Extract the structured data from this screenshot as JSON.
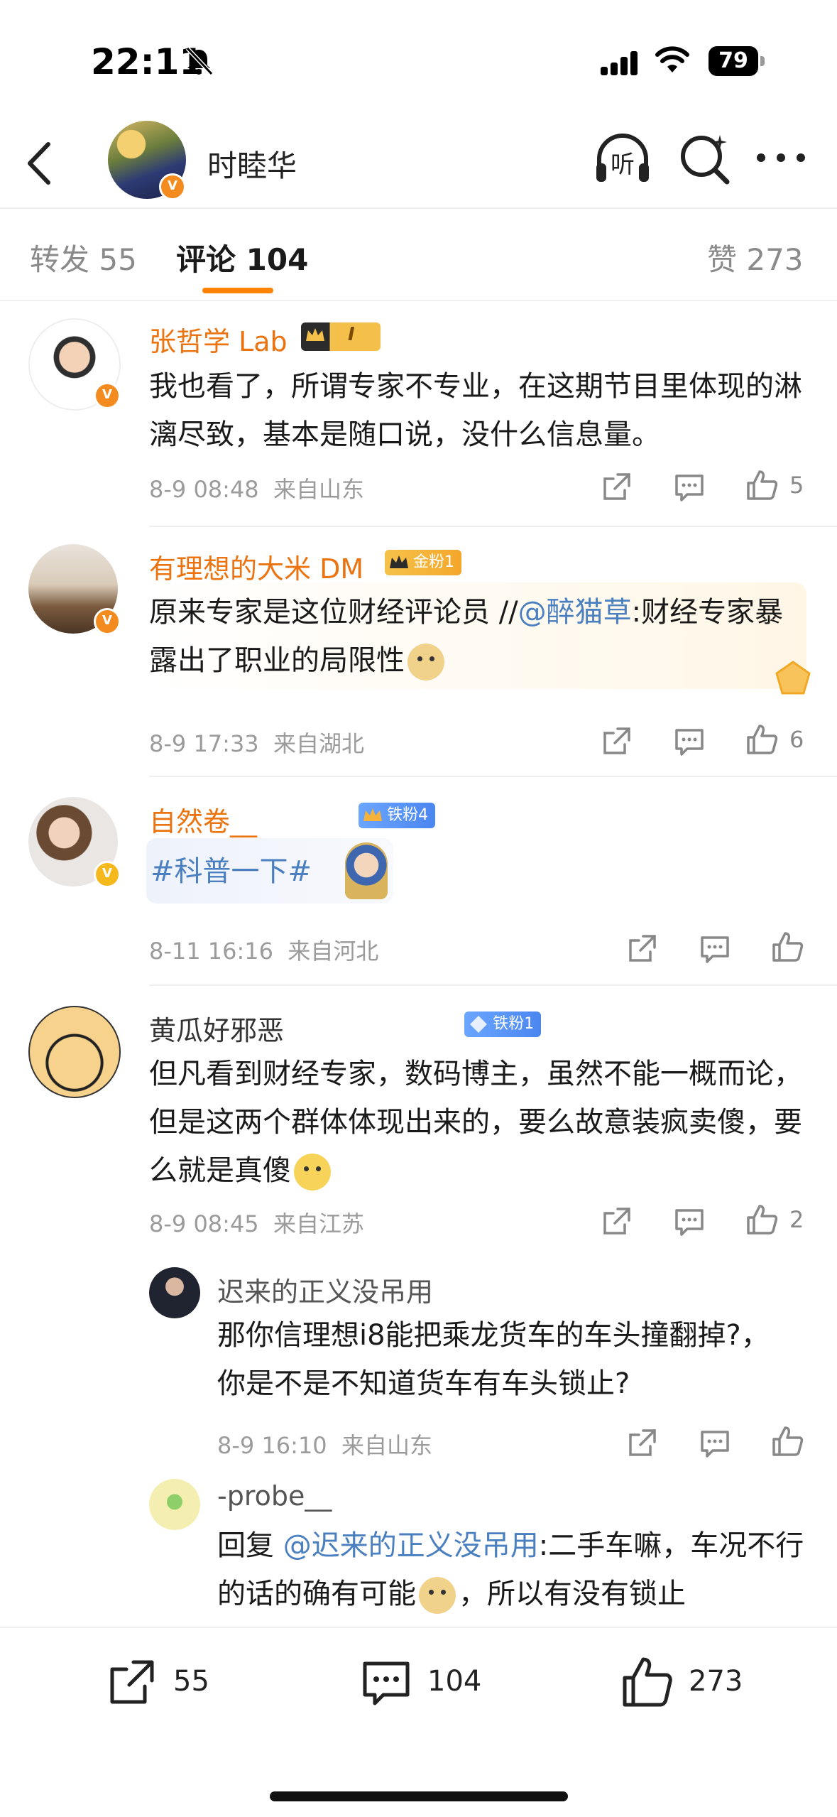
{
  "status_bar": {
    "time": "22:11",
    "battery": "79"
  },
  "header": {
    "title": "时睦华",
    "listen_label": "听"
  },
  "tabs": [
    {
      "label": "转发 55"
    },
    {
      "label": "评论 104"
    },
    {
      "label": "赞 273"
    }
  ],
  "comments": [
    {
      "user": "张哲学 Lab",
      "badge": "I",
      "text": "我也看了，所谓专家不专业，在这期节目里体现的淋漓尽致，基本是随口说，没什么信息量。",
      "time": "8-9 08:48",
      "location": "来自山东",
      "likes": "5"
    },
    {
      "user": "有理想的大米 DM",
      "badge": "金粉1",
      "text_before": "原来专家是这位财经评论员 //",
      "mention": "@醉猫草",
      "text_after": ":财经专家暴露出了职业的局限性",
      "time": "8-9 17:33",
      "location": "来自湖北",
      "likes": "6"
    },
    {
      "user": "自然卷__",
      "badge": "铁粉4",
      "hashtag": "#科普一下#",
      "time": "8-11 16:16",
      "location": "来自河北",
      "likes": ""
    },
    {
      "user": "黄瓜好邪恶",
      "badge": "铁粉1",
      "text": "但凡看到财经专家，数码博主，虽然不能一概而论，但是这两个群体体现出来的，要么故意装疯卖傻，要么就是真傻",
      "time": "8-9 08:45",
      "location": "来自江苏",
      "likes": "2"
    }
  ],
  "replies": [
    {
      "user": "迟来的正义没吊用",
      "text": "那你信理想i8能把乘龙货车的车头撞翻掉?， 你是不是不知道货车有车头锁止?",
      "time": "8-9 16:10",
      "location": "来自山东"
    },
    {
      "user": "-probe__",
      "prefix": "回复 ",
      "mention": "@迟来的正义没吊用",
      "text_a": ":二手车嘛，车况不行的话的确有可能",
      "text_b": "，所以有没有锁止"
    }
  ],
  "bottom_bar": {
    "repost": "55",
    "comment": "104",
    "like": "273"
  },
  "colors": {
    "accent": "#ff8200",
    "username": "#eb7310",
    "link": "#4a7fc0"
  }
}
